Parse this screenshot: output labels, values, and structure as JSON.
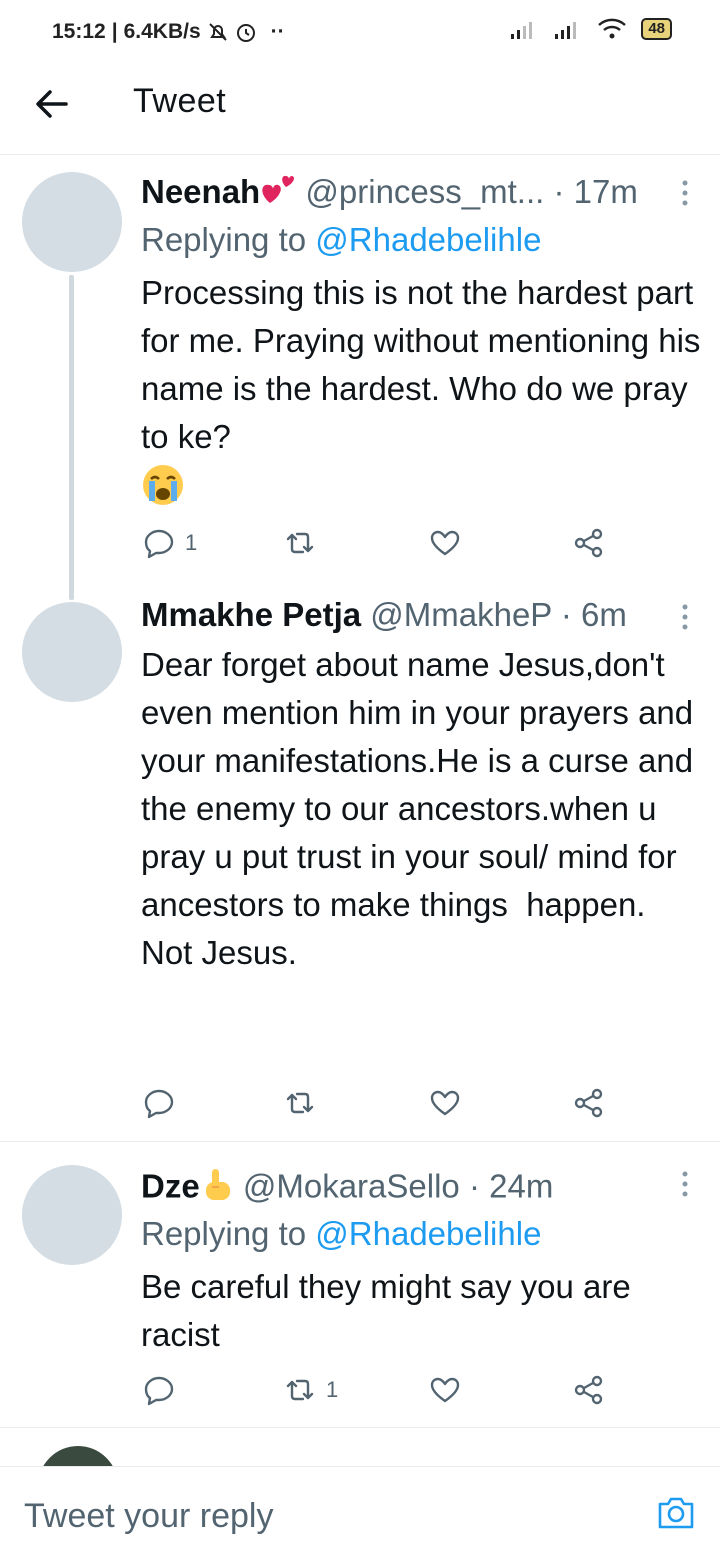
{
  "status_bar": {
    "time": "15:12",
    "network_speed": "6.4KB/s",
    "battery": "48"
  },
  "header": {
    "title": "Tweet"
  },
  "tweets": [
    {
      "name": "Neenah",
      "handle": "@princess_mt...",
      "time": "· 17m",
      "replying_label": "Replying to",
      "replying_to": "@Rhadebelihle",
      "text": "Processing this is not the hardest part for me. Praying without mentioning his name is the hardest. Who do we pray to ke?",
      "reply_count": "1",
      "retweet_count": "",
      "like_count": ""
    },
    {
      "name": "Mmakhe Petja",
      "handle": "@MmakheP",
      "time": "· 6m",
      "text": "Dear forget about name Jesus,don't even mention him in your prayers and your manifestations.He is a curse and the enemy to our ancestors.when u pray u put trust in your soul/ mind for\nancestors to make things  happen. Not Jesus.",
      "reply_count": "",
      "retweet_count": "",
      "like_count": ""
    },
    {
      "name": "Dze",
      "handle": "@MokaraSello",
      "time": "· 24m",
      "replying_label": "Replying to",
      "replying_to": "@Rhadebelihle",
      "text": "Be careful they might say you are racist",
      "reply_count": "",
      "retweet_count": "1",
      "like_count": ""
    }
  ],
  "reply_bar": {
    "placeholder": "Tweet your reply"
  },
  "colors": {
    "accent": "#1d9bf0",
    "muted": "#536471",
    "avatar": "#d4dde3"
  }
}
